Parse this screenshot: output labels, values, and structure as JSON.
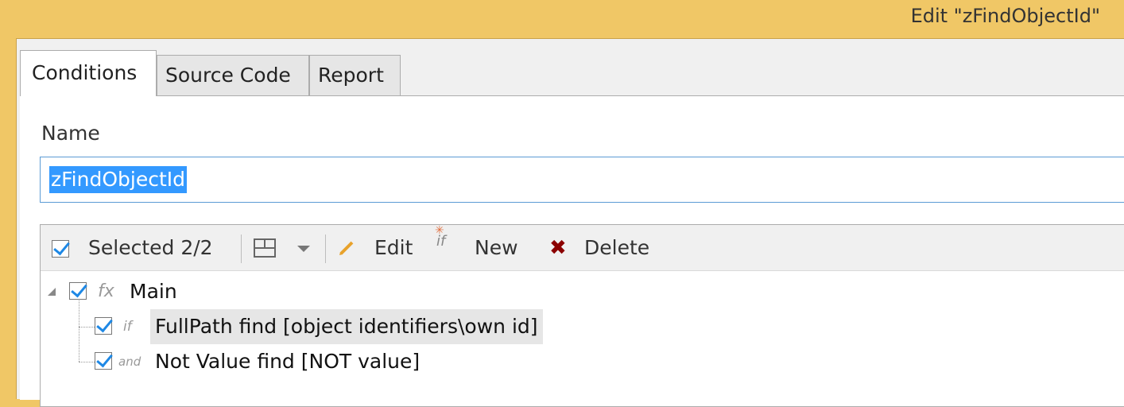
{
  "window": {
    "title": "Edit \"zFindObjectId\""
  },
  "tabs": [
    {
      "label": "Conditions"
    },
    {
      "label": "Source Code"
    },
    {
      "label": "Report"
    }
  ],
  "form": {
    "name_label": "Name",
    "name_value": "zFindObjectId"
  },
  "toolbar": {
    "selected_label": "Selected 2/2",
    "edit_label": "Edit",
    "new_label": "New",
    "delete_label": "Delete",
    "new_icon_text": "if"
  },
  "tree": {
    "root": {
      "label": "Main",
      "icon": "function-icon",
      "icon_text": "fx"
    },
    "children": [
      {
        "icon_text": "if",
        "label": "FullPath find [object identifiers\\own id]"
      },
      {
        "icon_text": "and",
        "label": "Not Value find [NOT value]"
      }
    ]
  },
  "colors": {
    "titlebar": "#f0c766",
    "selection": "#3399ff",
    "focus_border": "#5b9bd5",
    "check": "#1e88e5",
    "delete_icon": "#8b0000",
    "edit_icon": "#e8a22b"
  }
}
